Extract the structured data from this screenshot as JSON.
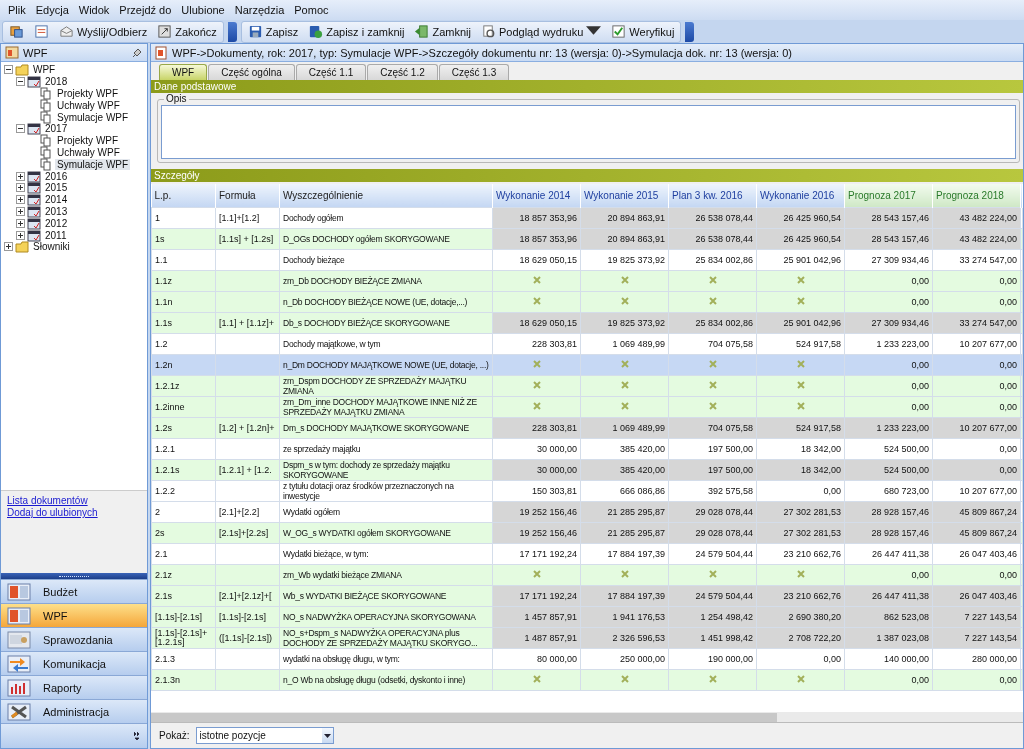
{
  "menu": [
    "Plik",
    "Edycja",
    "Widok",
    "Przejdź do",
    "Ulubione",
    "Narzędzia",
    "Pomoc"
  ],
  "toolbar": {
    "left": [
      {
        "kind": "icon"
      },
      {
        "kind": "icon"
      },
      {
        "kind": "text",
        "label": "Wyślij/Odbierz"
      },
      {
        "kind": "text",
        "label": "Zakończ"
      }
    ],
    "right": [
      {
        "kind": "text",
        "label": "Zapisz"
      },
      {
        "kind": "text",
        "label": "Zapisz i zamknij"
      },
      {
        "kind": "text",
        "label": "Zamknij"
      },
      {
        "kind": "text",
        "label": "Podgląd wydruku",
        "dropdown": true
      },
      {
        "kind": "text",
        "label": "Weryfikuj"
      }
    ]
  },
  "sidebar": {
    "title": "WPF",
    "tree": [
      {
        "label": "WPF",
        "expanded": true,
        "selected": false,
        "children": [
          {
            "label": "2018",
            "expanded": true,
            "selected": false,
            "children": [
              {
                "label": "Projekty WPF",
                "selected": false
              },
              {
                "label": "Uchwały WPF",
                "selected": false
              },
              {
                "label": "Symulacje WPF",
                "selected": false
              }
            ]
          },
          {
            "label": "2017",
            "expanded": true,
            "selected": false,
            "children": [
              {
                "label": "Projekty WPF",
                "selected": false
              },
              {
                "label": "Uchwały WPF",
                "selected": false
              },
              {
                "label": "Symulacje WPF",
                "selected": true
              }
            ]
          },
          {
            "label": "2016",
            "expanded": false,
            "selected": false
          },
          {
            "label": "2015",
            "expanded": false,
            "selected": false
          },
          {
            "label": "2014",
            "expanded": false,
            "selected": false
          },
          {
            "label": "2013",
            "expanded": false,
            "selected": false
          },
          {
            "label": "2012",
            "expanded": false,
            "selected": false
          },
          {
            "label": "2011",
            "expanded": false,
            "selected": false
          }
        ]
      },
      {
        "label": "Słowniki",
        "expanded": false,
        "selected": false
      }
    ],
    "links": [
      "Lista dokumentów",
      "Dodaj do ulubionych"
    ],
    "nav": [
      {
        "label": "Budżet",
        "selected": false
      },
      {
        "label": "WPF",
        "selected": true
      },
      {
        "label": "Sprawozdania",
        "selected": false
      },
      {
        "label": "Komunikacja",
        "selected": false
      },
      {
        "label": "Raporty",
        "selected": false
      },
      {
        "label": "Administracja",
        "selected": false
      }
    ]
  },
  "breadcrumb": "WPF->Dokumenty, rok: 2017, typ: Symulacje WPF->Szczegóły dokumentu nr: 13 (wersja: 0)->Symulacja dok. nr: 13 (wersja: 0)",
  "tabs": [
    {
      "label": "WPF",
      "selected": true
    },
    {
      "label": "Część ogólna",
      "selected": false
    },
    {
      "label": "Część 1.1",
      "selected": false
    },
    {
      "label": "Część 1.2",
      "selected": false
    },
    {
      "label": "Część 1.3",
      "selected": false
    }
  ],
  "basic_section": {
    "title": "Dane podstawowe",
    "description_label": "Opis"
  },
  "details_section": {
    "title": "Szczegóły"
  },
  "table": {
    "columns": [
      {
        "label": "L.p.",
        "kind": "text"
      },
      {
        "label": "Formuła",
        "kind": "text"
      },
      {
        "label": "Wyszczególnienie",
        "kind": "text"
      },
      {
        "label": "Wykonanie 2014",
        "kind": "actual"
      },
      {
        "label": "Wykonanie 2015",
        "kind": "actual"
      },
      {
        "label": "Plan 3 kw. 2016",
        "kind": "actual"
      },
      {
        "label": "Wykonanie 2016",
        "kind": "actual"
      },
      {
        "label": "Prognoza 2017",
        "kind": "forecast"
      },
      {
        "label": "Prognoza 2018",
        "kind": "forecast"
      }
    ],
    "rows": [
      {
        "lp": "1",
        "formula": "[1.1]+[1.2]",
        "name": "Dochody ogółem",
        "shaded": false,
        "computed": true,
        "selected": false,
        "values": [
          "18 857 353,96",
          "20 894 863,91",
          "26 538 078,44",
          "26 425 960,54",
          "28 543 157,46",
          "43 482 224,00"
        ]
      },
      {
        "lp": "1s",
        "formula": "[1.1s] + [1.2s]",
        "name": "D_OGs DOCHODY ogółem SKORYGOWANE",
        "shaded": true,
        "computed": true,
        "selected": false,
        "values": [
          "18 857 353,96",
          "20 894 863,91",
          "26 538 078,44",
          "26 425 960,54",
          "28 543 157,46",
          "43 482 224,00"
        ]
      },
      {
        "lp": "1.1",
        "name": "Dochody bieżące",
        "shaded": false,
        "computed": false,
        "selected": false,
        "values": [
          "18 629 050,15",
          "19 825 373,92",
          "25 834 002,86",
          "25 901 042,96",
          "27 309 934,46",
          "33 274 547,00"
        ]
      },
      {
        "lp": "1.1z",
        "name": "zm_Db DOCHODY BIEŻĄCE ZMIANA",
        "shaded": true,
        "computed": false,
        "selected": false,
        "values": [
          {
            "kind": "not_applicable"
          },
          {
            "kind": "not_applicable"
          },
          {
            "kind": "not_applicable"
          },
          {
            "kind": "not_applicable"
          },
          "0,00",
          "0,00"
        ]
      },
      {
        "lp": "1.1n",
        "name": "n_Db DOCHODY BIEŻĄCE NOWE (UE, dotacje,...)",
        "shaded": true,
        "computed": false,
        "selected": false,
        "values": [
          {
            "kind": "not_applicable"
          },
          {
            "kind": "not_applicable"
          },
          {
            "kind": "not_applicable"
          },
          {
            "kind": "not_applicable"
          },
          "0,00",
          "0,00"
        ]
      },
      {
        "lp": "1.1s",
        "formula": "[1.1] + [1.1z]+",
        "name": "Db_s DOCHODY BIEŻĄCE SKORYGOWANE",
        "shaded": true,
        "computed": true,
        "selected": false,
        "values": [
          "18 629 050,15",
          "19 825 373,92",
          "25 834 002,86",
          "25 901 042,96",
          "27 309 934,46",
          "33 274 547,00"
        ]
      },
      {
        "lp": "1.2",
        "name": "Dochody majątkowe, w tym",
        "shaded": false,
        "computed": false,
        "selected": false,
        "values": [
          "228 303,81",
          "1 069 489,99",
          "704 075,58",
          "524 917,58",
          "1 233 223,00",
          "10 207 677,00"
        ]
      },
      {
        "lp": "1.2n",
        "name": "n_Dm DOCHODY MAJĄTKOWE NOWE (UE, dotacje, ...)",
        "selected": true,
        "values": [
          {
            "kind": "not_applicable"
          },
          {
            "kind": "not_applicable"
          },
          {
            "kind": "not_applicable"
          },
          {
            "kind": "not_applicable"
          },
          "0,00",
          "0,00"
        ]
      },
      {
        "lp": "1.2.1z",
        "name": "zm_Dspm DOCHODY ZE SPRZEDAŻY MAJĄTKU ZMIANA",
        "shaded": true,
        "computed": false,
        "selected": false,
        "values": [
          {
            "kind": "not_applicable"
          },
          {
            "kind": "not_applicable"
          },
          {
            "kind": "not_applicable"
          },
          {
            "kind": "not_applicable"
          },
          "0,00",
          "0,00"
        ]
      },
      {
        "lp": "1.2inne",
        "name": "zm_Dm_inne DOCHODY MAJĄTKOWE INNE NIŻ ZE SPRZEDAŻY MAJĄTKU ZMIANA",
        "shaded": true,
        "computed": false,
        "selected": false,
        "values": [
          {
            "kind": "not_applicable"
          },
          {
            "kind": "not_applicable"
          },
          {
            "kind": "not_applicable"
          },
          {
            "kind": "not_applicable"
          },
          "0,00",
          "0,00"
        ]
      },
      {
        "lp": "1.2s",
        "formula": "[1.2] + [1.2n]+",
        "name": "Dm_s DOCHODY MAJĄTKOWE SKORYGOWANE",
        "shaded": true,
        "computed": true,
        "selected": false,
        "values": [
          "228 303,81",
          "1 069 489,99",
          "704 075,58",
          "524 917,58",
          "1 233 223,00",
          "10 207 677,00"
        ]
      },
      {
        "lp": "1.2.1",
        "name": "ze sprzedaży majątku",
        "shaded": false,
        "computed": false,
        "selected": false,
        "values": [
          "30 000,00",
          "385 420,00",
          "197 500,00",
          "18 342,00",
          "524 500,00",
          "0,00"
        ]
      },
      {
        "lp": "1.2.1s",
        "formula": "[1.2.1] + [1.2.",
        "name": "Dspm_s w tym: dochody ze sprzedaży majątku SKORYGOWANE",
        "shaded": true,
        "computed": true,
        "selected": false,
        "values": [
          "30 000,00",
          "385 420,00",
          "197 500,00",
          "18 342,00",
          "524 500,00",
          "0,00"
        ]
      },
      {
        "lp": "1.2.2",
        "name": "z tytułu dotacji oraz środków przeznaczonych na inwestycje",
        "shaded": false,
        "computed": false,
        "selected": false,
        "values": [
          "150 303,81",
          "666 086,86",
          "392 575,58",
          "0,00",
          "680 723,00",
          "10 207 677,00"
        ]
      },
      {
        "lp": "2",
        "formula": "[2.1]+[2.2]",
        "name": "Wydatki ogółem",
        "shaded": false,
        "computed": true,
        "selected": false,
        "values": [
          "19 252 156,46",
          "21 285 295,87",
          "29 028 078,44",
          "27 302 281,53",
          "28 928 157,46",
          "45 809 867,24"
        ]
      },
      {
        "lp": "2s",
        "formula": "[2.1s]+[2.2s]",
        "name": "W_OG_s WYDATKI ogółem SKORYGOWANE",
        "shaded": true,
        "computed": true,
        "selected": false,
        "values": [
          "19 252 156,46",
          "21 285 295,87",
          "29 028 078,44",
          "27 302 281,53",
          "28 928 157,46",
          "45 809 867,24"
        ]
      },
      {
        "lp": "2.1",
        "name": "Wydatki bieżące, w tym:",
        "shaded": false,
        "computed": false,
        "selected": false,
        "values": [
          "17 171 192,24",
          "17 884 197,39",
          "24 579 504,44",
          "23 210 662,76",
          "26 447 411,38",
          "26 047 403,46"
        ]
      },
      {
        "lp": "2.1z",
        "name": "zm_Wb wydatki bieżące ZMIANA",
        "shaded": true,
        "computed": false,
        "selected": false,
        "values": [
          {
            "kind": "not_applicable"
          },
          {
            "kind": "not_applicable"
          },
          {
            "kind": "not_applicable"
          },
          {
            "kind": "not_applicable"
          },
          "0,00",
          "0,00"
        ]
      },
      {
        "lp": "2.1s",
        "formula": "[2.1]+[2.1z]+[",
        "name": "Wb_s WYDATKI BIEŻĄCE SKORYGOWANE",
        "shaded": true,
        "computed": true,
        "selected": false,
        "values": [
          "17 171 192,24",
          "17 884 197,39",
          "24 579 504,44",
          "23 210 662,76",
          "26 447 411,38",
          "26 047 403,46"
        ]
      },
      {
        "lp": "[1.1s]-[2.1s]",
        "formula": "[1.1s]-[2.1s]",
        "name": "NO_s NADWYŻKA OPERACYJNA SKORYGOWANA",
        "shaded": true,
        "computed": true,
        "selected": false,
        "values": [
          "1 457 857,91",
          "1 941 176,53",
          "1 254 498,42",
          "2 690 380,20",
          "862 523,08",
          "7 227 143,54"
        ]
      },
      {
        "lp": "[1.1s]-[2.1s]+[1.2.1s]",
        "formula": "([1.1s]-[2.1s])",
        "name": "NO_s+Dspm_s NADWYŻKA OPERACYJNA plus DOCHODY ZE SPRZEDAŻY MAJĄTKU SKORYGO...",
        "shaded": true,
        "computed": true,
        "selected": false,
        "values": [
          "1 487 857,91",
          "2 326 596,53",
          "1 451 998,42",
          "2 708 722,20",
          "1 387 023,08",
          "7 227 143,54"
        ]
      },
      {
        "lp": "2.1.3",
        "name": "wydatki na obsługę długu, w tym:",
        "shaded": false,
        "computed": false,
        "selected": false,
        "values": [
          "80 000,00",
          "250 000,00",
          "190 000,00",
          "0,00",
          "140 000,00",
          "280 000,00"
        ]
      },
      {
        "lp": "2.1.3n",
        "name": "n_O Wb na obsługę długu (odsetki, dyskonto i inne)",
        "shaded": true,
        "computed": false,
        "selected": false,
        "values": [
          {
            "kind": "not_applicable"
          },
          {
            "kind": "not_applicable"
          },
          {
            "kind": "not_applicable"
          },
          {
            "kind": "not_applicable"
          },
          "0,00",
          "0,00"
        ]
      }
    ]
  },
  "filter": {
    "label": "Pokaż:",
    "value": "istotne pozycje"
  }
}
